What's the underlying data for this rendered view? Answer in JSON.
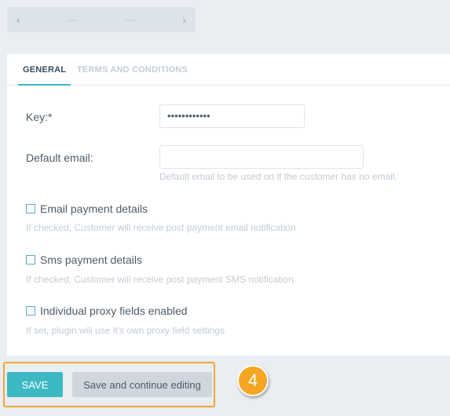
{
  "pager": {
    "prev_icon": "‹",
    "next_icon": "›",
    "dash_left": "—",
    "dash_right": "—"
  },
  "tabs": [
    {
      "label": "GENERAL"
    },
    {
      "label": "TERMS AND CONDITIONS"
    }
  ],
  "form": {
    "key_label": "Key:*",
    "key_value": "••••••••••••",
    "default_email_label": "Default email:",
    "default_email_value": "",
    "default_email_hint": "Default email to be used on if the customer has no email.",
    "email_payment_label": "Email payment details",
    "email_payment_hint": "If checked, Customer will receive post payment email notification",
    "sms_payment_label": "Sms payment details",
    "sms_payment_hint": "If checked, Customer will receive post payment SMS notification",
    "proxy_label": "Individual proxy fields enabled",
    "proxy_hint": "If set, plugin will use it's own proxy field settings"
  },
  "actions": {
    "save_label": "SAVE",
    "continue_label": "Save and continue editing"
  },
  "step_badge": "4",
  "colors": {
    "accent": "#3cb9c2",
    "highlight": "#f0a63a",
    "badge": "#f5a623"
  }
}
